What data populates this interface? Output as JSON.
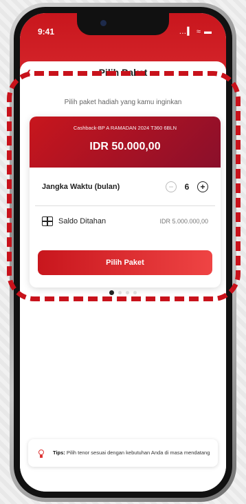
{
  "status_bar": {
    "time": "9:41",
    "icons": "…▍ ≈ ▬"
  },
  "header": {
    "title": "Pilih Paket"
  },
  "subtitle": "Pilih paket hadiah yang kamu inginkan",
  "package": {
    "name": "Cashback-BP A RAMADAN 2024 T360 6BLN",
    "amount": "IDR 50.000,00",
    "term_label": "Jangka Waktu (bulan)",
    "term_value": "6",
    "minus_symbol": "−",
    "plus_symbol": "+",
    "saldo_label": "Saldo Ditahan",
    "saldo_value": "IDR 5.000.000,00",
    "cta_label": "Pilih Paket"
  },
  "pagination": {
    "current": 1,
    "total": 4
  },
  "tips": {
    "label": "Tips:",
    "text": "Pilih tenor sesuai dengan kebutuhan Anda di masa mendatang"
  },
  "colors": {
    "primary": "#c8161d",
    "dash": "#c8121b"
  }
}
